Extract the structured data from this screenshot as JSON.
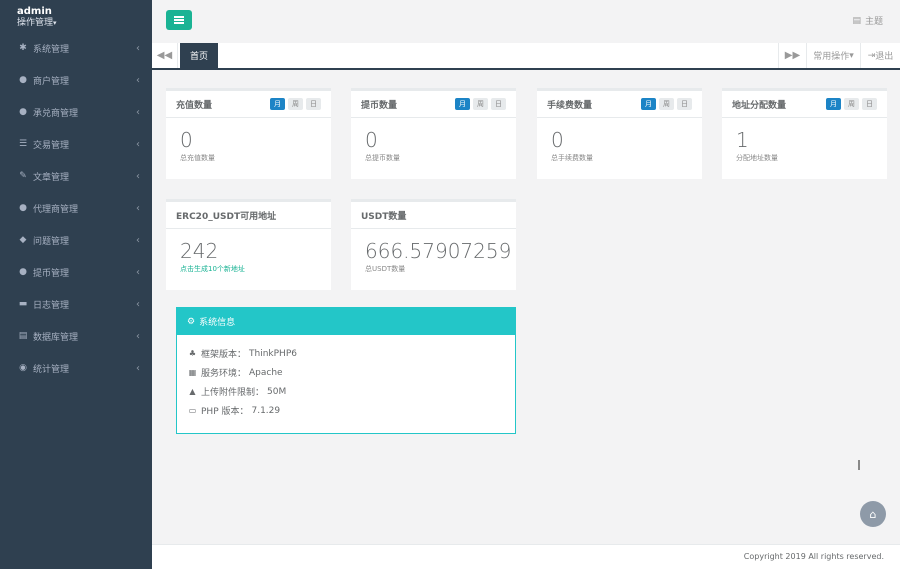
{
  "user": {
    "name": "admin",
    "role": "操作管理"
  },
  "sidebar": {
    "items": [
      {
        "label": "系统管理",
        "icon": "gear-icon"
      },
      {
        "label": "商户管理",
        "icon": "user-icon"
      },
      {
        "label": "承兑商管理",
        "icon": "user-icon"
      },
      {
        "label": "交易管理",
        "icon": "list-icon"
      },
      {
        "label": "文章管理",
        "icon": "edit-icon"
      },
      {
        "label": "代理商管理",
        "icon": "user-icon"
      },
      {
        "label": "问题管理",
        "icon": "comment-icon"
      },
      {
        "label": "提币管理",
        "icon": "user-icon"
      },
      {
        "label": "日志管理",
        "icon": "file-icon"
      },
      {
        "label": "数据库管理",
        "icon": "database-icon"
      },
      {
        "label": "统计管理",
        "icon": "chart-icon"
      }
    ]
  },
  "header": {
    "theme_label": "主题"
  },
  "tabs": {
    "home": "首页",
    "ops": "常用操作",
    "logout": "退出"
  },
  "periods": {
    "month": "月",
    "week": "周",
    "day": "日"
  },
  "stats": [
    {
      "title": "充值数量",
      "value": "0",
      "sub": "总充值数量"
    },
    {
      "title": "提币数量",
      "value": "0",
      "sub": "总提币数量"
    },
    {
      "title": "手续费数量",
      "value": "0",
      "sub": "总手续费数量"
    },
    {
      "title": "地址分配数量",
      "value": "1",
      "sub": "分配地址数量"
    }
  ],
  "address_card": {
    "title": "ERC20_USDT可用地址",
    "value": "242",
    "link": "点击生成10个新地址"
  },
  "usdt_card": {
    "title": "USDT数量",
    "value": "666.57907259",
    "sub": "总USDT数量"
  },
  "system": {
    "title": "系统信息",
    "rows": [
      {
        "label": "框架版本：",
        "value": "ThinkPHP6",
        "icon": "sitemap-icon"
      },
      {
        "label": "服务环境：",
        "value": "Apache",
        "icon": "windows-icon"
      },
      {
        "label": "上传附件限制：",
        "value": "50M",
        "icon": "warning-icon"
      },
      {
        "label": "PHP 版本：",
        "value": "7.1.29",
        "icon": "credit-card-icon"
      }
    ]
  },
  "footer": {
    "copyright": "Copyright 2019 All rights reserved."
  }
}
